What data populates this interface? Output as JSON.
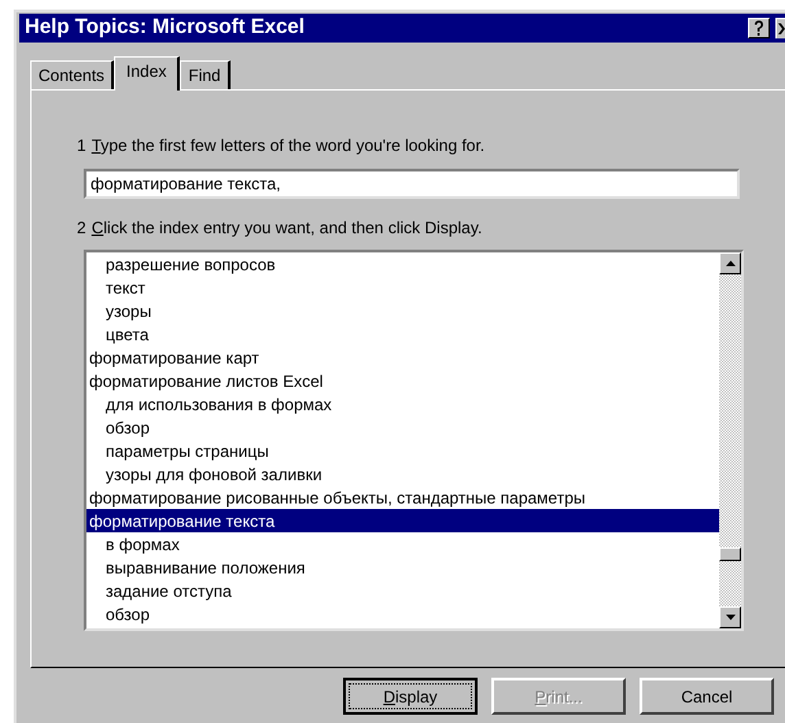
{
  "window": {
    "title": "Help Topics: Microsoft Excel"
  },
  "tabs": [
    {
      "label": "Contents",
      "selected": false
    },
    {
      "label": "Index",
      "selected": true
    },
    {
      "label": "Find",
      "selected": false
    }
  ],
  "step_1": {
    "number": "1",
    "label": "Type the first few letters of the word you're looking for.",
    "underline_first": true
  },
  "search": {
    "value": "форматирование текста,"
  },
  "step_2": {
    "number": "2",
    "label": "Click the index entry you want, and then click Display.",
    "underline_first": true
  },
  "index_entries": [
    {
      "children": [
        {
          "label": "разрешение вопросов",
          "selected": false
        },
        {
          "label": "текст",
          "selected": false
        },
        {
          "label": "узоры",
          "selected": false
        },
        {
          "label": "цвета",
          "selected": false
        }
      ]
    },
    {
      "label": "форматирование карт",
      "selected": false
    },
    {
      "label": "форматирование листов Excel",
      "selected": false,
      "children": [
        {
          "label": "для использования в формах",
          "selected": false
        },
        {
          "label": "обзор",
          "selected": false
        },
        {
          "label": "параметры страницы",
          "selected": false
        },
        {
          "label": "узоры для фоновой заливки",
          "selected": false
        }
      ]
    },
    {
      "label": "форматирование рисованные объекты, стандартные параметры",
      "selected": false
    },
    {
      "label": "форматирование текста",
      "selected": true,
      "children": [
        {
          "label": "в формах",
          "selected": false
        },
        {
          "label": "выравнивание положения",
          "selected": false
        },
        {
          "label": "задание отступа",
          "selected": false
        },
        {
          "label": "обзор",
          "selected": false
        }
      ]
    }
  ],
  "buttons": [
    {
      "label": "Display",
      "underline_first": true,
      "default": true,
      "disabled": false
    },
    {
      "label": "Print...",
      "underline_first": true,
      "default": false,
      "disabled": true
    },
    {
      "label": "Cancel",
      "default": false,
      "disabled": false
    }
  ]
}
